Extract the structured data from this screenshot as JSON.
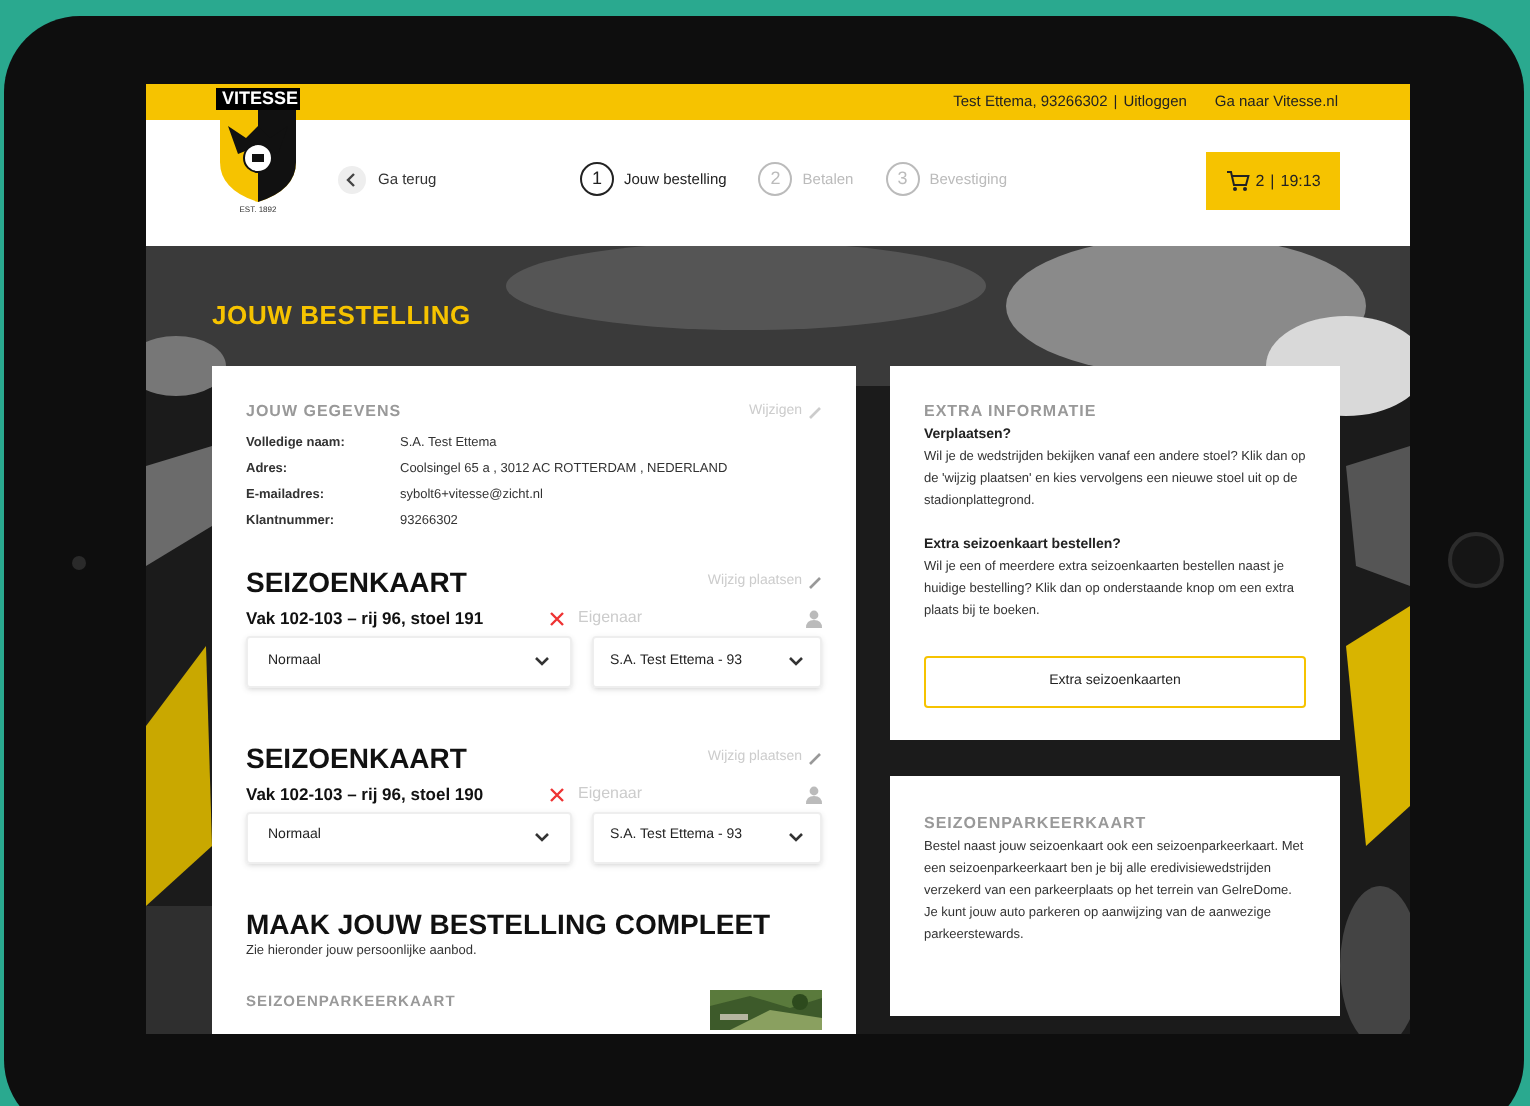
{
  "top_bar": {
    "user": "Test Ettema, 93266302",
    "separator": "|",
    "logout": "Uitloggen",
    "site_link": "Ga naar Vitesse.nl"
  },
  "logo": {
    "name": "VITESSE",
    "est": "EST. 1892"
  },
  "back": {
    "label": "Ga terug"
  },
  "steps": [
    {
      "number": "1",
      "label": "Jouw bestelling",
      "selected": true
    },
    {
      "number": "2",
      "label": "Betalen",
      "selected": false
    },
    {
      "number": "3",
      "label": "Bevestiging",
      "selected": false
    }
  ],
  "cart": {
    "count": "2",
    "separator": "|",
    "timer": "19:13"
  },
  "page_title": "JOUW BESTELLING",
  "details": {
    "title": "JOUW GEGEVENS",
    "edit": "Wijzigen",
    "fields": [
      {
        "label": "Volledige naam:",
        "value": "S.A. Test Ettema"
      },
      {
        "label": "Adres:",
        "value": "Coolsingel 65 a , 3012 AC ROTTERDAM , NEDERLAND"
      },
      {
        "label": "E-mailadres:",
        "value": "sybolt6+vitesse@zicht.nl"
      },
      {
        "label": "Klantnummer:",
        "value": "93266302"
      }
    ]
  },
  "tickets": [
    {
      "title": "SEIZOENKAART",
      "edit": "Wijzig plaatsen",
      "seat": "Vak 102-103 – rij 96, stoel 191",
      "owner_label": "Eigenaar",
      "type": "Normaal",
      "owner": "S.A. Test Ettema - 93"
    },
    {
      "title": "SEIZOENKAART",
      "edit": "Wijzig plaatsen",
      "seat": "Vak 102-103 – rij 96, stoel 190",
      "owner_label": "Eigenaar",
      "type": "Normaal",
      "owner": "S.A. Test Ettema - 93"
    }
  ],
  "complete": {
    "title": "MAAK JOUW BESTELLING COMPLEET",
    "subtitle": "Zie hieronder jouw persoonlijke aanbod.",
    "offer_title": "SEIZOENPARKEERKAART"
  },
  "info": {
    "title": "EXTRA INFORMATIE",
    "sections": [
      {
        "heading": "Verplaatsen?",
        "text": "Wil je de wedstrijden bekijken vanaf een andere stoel? Klik dan op de 'wijzig plaatsen' en kies vervolgens een nieuwe stoel uit op de stadionplattegrond."
      },
      {
        "heading": "Extra seizoenkaart bestellen?",
        "text": "Wil je een of meerdere extra seizoenkaarten bestellen naast je huidige bestelling? Klik dan op onderstaande knop om een extra plaats bij te boeken."
      }
    ],
    "button": "Extra seizoenkaarten"
  },
  "parking": {
    "title": "SEIZOENPARKEERKAART",
    "text": "Bestel naast jouw seizoenkaart ook een seizoenparkeerkaart. Met een seizoenparkeerkaart ben je bij alle eredivisiewedstrijden verzekerd van een parkeerplaats op het terrein van GelreDome. Je kunt jouw auto parkeren op aanwijzing van de aanwezige parkeerstewards."
  }
}
